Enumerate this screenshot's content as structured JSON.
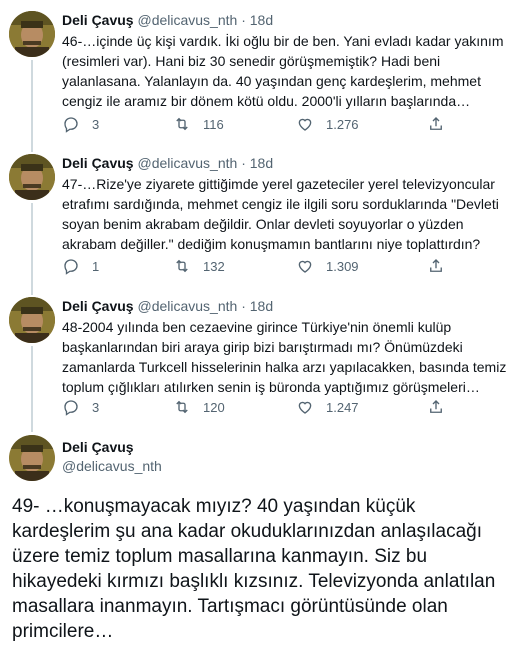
{
  "author": {
    "name": "Deli Çavuş",
    "handle": "@delicavus_nth",
    "separator": "·"
  },
  "tweets": [
    {
      "time": "18d",
      "text": "46-…içinde üç kişi vardık. İki oğlu bir de ben. Yani evladı kadar yakınım (resimleri var). Hani biz 30 senedir görüşmemiştik? Hadi beni yalanlasana. Yalanlayın da. 40 yaşından genç kardeşlerim, mehmet cengiz ile aramız bir dönem kötü oldu. 2000'li yılların başlarında…",
      "replies": "3",
      "retweets": "116",
      "likes": "1.276"
    },
    {
      "time": "18d",
      "text": "47-…Rize'ye ziyarete gittiğimde yerel gazeteciler yerel televizyoncular etrafımı sardığında, mehmet cengiz ile ilgili soru sorduklarında \"Devleti soyan benim akrabam değildir. Onlar devleti soyuyorlar o yüzden akrabam değiller.\" dediğim konuşmamın bantlarını niye toplattırdın?",
      "replies": "1",
      "retweets": "132",
      "likes": "1.309"
    },
    {
      "time": "18d",
      "text": "48-2004 yılında ben cezaevine girince Türkiye'nin önemli kulüp başkanlarından biri araya girip bizi barıştırmadı mı? Önümüzdeki zamanlarda Turkcell hisselerinin halka arzı yapılacakken, basında temiz toplum çığlıkları atılırken senin iş büronda yaptığımız görüşmeleri…",
      "replies": "3",
      "retweets": "120",
      "likes": "1.247"
    }
  ],
  "main_tweet": {
    "text": "49- …konuşmayacak mıyız? 40 yaşından küçük kardeşlerim şu ana kadar okuduklarınızdan anlaşılacağı üzere temiz toplum masallarına kanmayın. Siz bu hikayedeki kırmızı başlıklı kızsınız. Televizyonda anlatılan masallara inanmayın. Tartışmacı görüntüsünde olan primcilere…"
  },
  "icons": {
    "reply": "reply-icon",
    "retweet": "retweet-icon",
    "like": "heart-icon",
    "share": "share-icon"
  },
  "colors": {
    "text": "#0f1419",
    "secondary": "#536471",
    "thread_line": "#cfd9de"
  }
}
